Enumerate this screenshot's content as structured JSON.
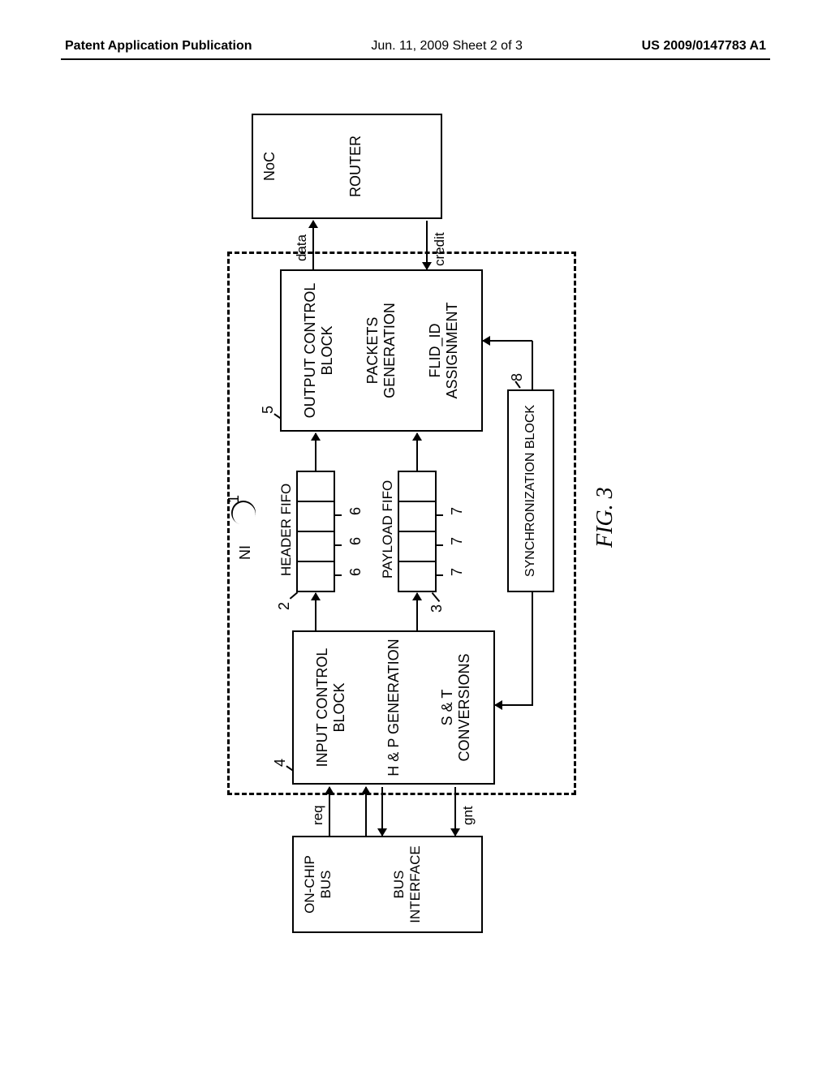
{
  "header": {
    "left": "Patent Application Publication",
    "center": "Jun. 11, 2009  Sheet 2 of 3",
    "right": "US 2009/0147783 A1"
  },
  "left_block": {
    "title": "ON-CHIP BUS",
    "sub": "BUS INTERFACE"
  },
  "signals_left": {
    "req": "req",
    "gnt": "gnt"
  },
  "ni_label": "NI",
  "input_block": {
    "title": "INPUT CONTROL BLOCK",
    "l1": "H & P GENERATION",
    "l2": "S & T CONVERSIONS"
  },
  "fifos": {
    "header": "HEADER FIFO",
    "payload": "PAYLOAD FIFO"
  },
  "sync": "SYNCHRONIZATION BLOCK",
  "output_block": {
    "title": "OUTPUT CONTROL BLOCK",
    "l1": "PACKETS GENERATION",
    "l2": "FLID_ID ASSIGNMENT"
  },
  "signals_right": {
    "data": "data",
    "credit": "credit"
  },
  "right_block": {
    "title": "NoC",
    "sub": "ROUTER"
  },
  "refs": {
    "r1": "1",
    "r2": "2",
    "r3": "3",
    "r4": "4",
    "r5": "5",
    "r6a": "6",
    "r6b": "6",
    "r6c": "6",
    "r7a": "7",
    "r7b": "7",
    "r7c": "7",
    "r8": "8"
  },
  "caption": "FIG. 3"
}
